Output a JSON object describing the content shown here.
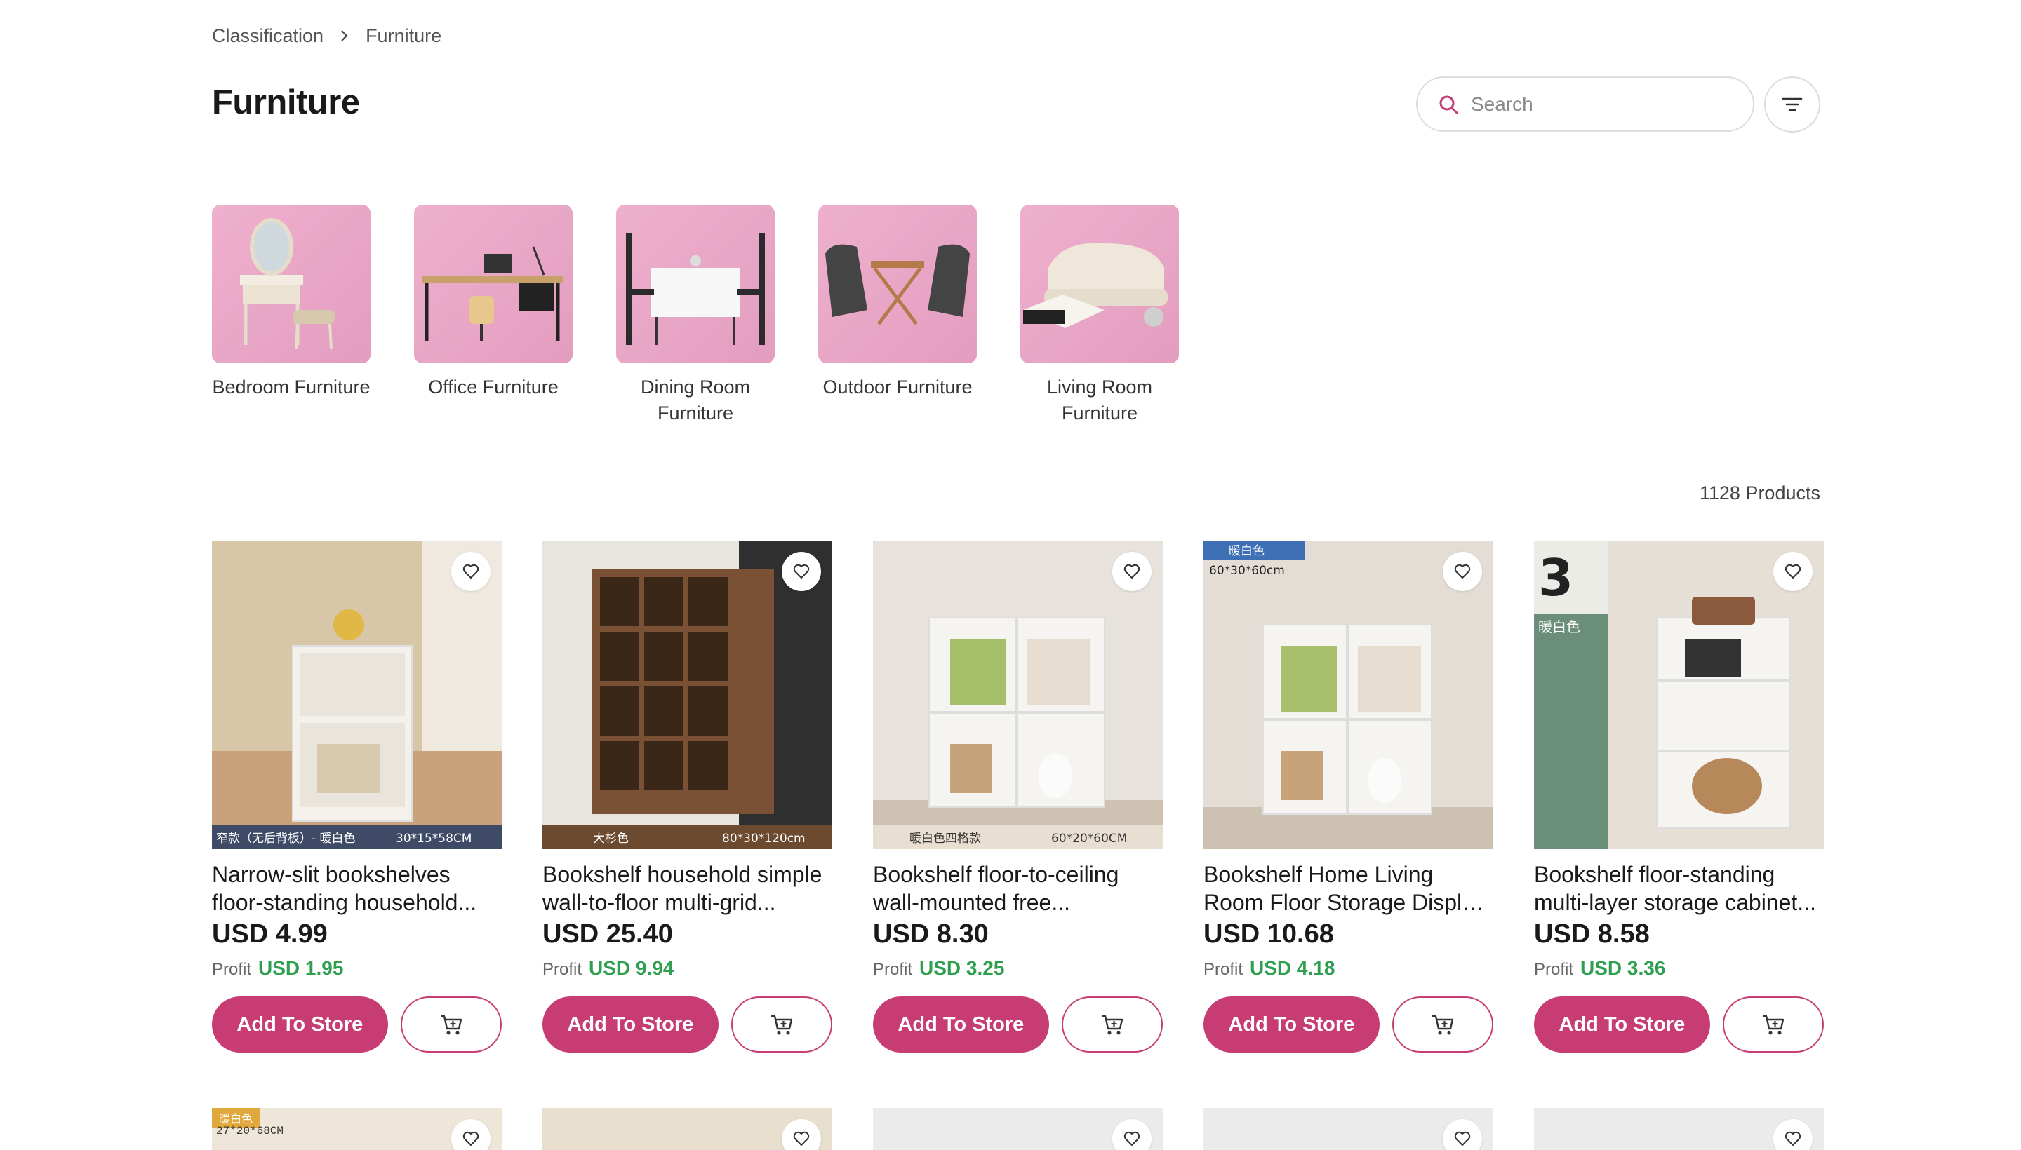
{
  "breadcrumb": {
    "root": "Classification",
    "current": "Furniture"
  },
  "page_title": "Furniture",
  "search": {
    "placeholder": "Search"
  },
  "categories": [
    {
      "label": "Bedroom Furniture"
    },
    {
      "label": "Office Furniture"
    },
    {
      "label": "Dining Room Furniture"
    },
    {
      "label": "Outdoor Furniture"
    },
    {
      "label": "Living Room Furniture"
    }
  ],
  "product_count": "1128 Products",
  "products": [
    {
      "title": "Narrow-slit bookshelves floor-standing household...",
      "price": "USD 4.99",
      "profit_label": "Profit",
      "profit": "USD 1.95",
      "add_label": "Add To Store",
      "img_left": "窄款（无后背板）- 暖白色",
      "img_right": "30*15*58CM"
    },
    {
      "title": "Bookshelf household simple wall-to-floor multi-grid...",
      "price": "USD 25.40",
      "profit_label": "Profit",
      "profit": "USD 9.94",
      "add_label": "Add To Store",
      "img_left": "大杉色",
      "img_right": "80*30*120cm"
    },
    {
      "title": "Bookshelf floor-to-ceiling wall-mounted free...",
      "price": "USD 8.30",
      "profit_label": "Profit",
      "profit": "USD 3.25",
      "add_label": "Add To Store",
      "img_left": "暖白色四格款",
      "img_right": "60*20*60CM"
    },
    {
      "title": "Bookshelf Home Living Room Floor Storage Display Cabin...",
      "price": "USD 10.68",
      "profit_label": "Profit",
      "profit": "USD 4.18",
      "add_label": "Add To Store",
      "img_tag": "暖白色",
      "img_size": "60*30*60cm"
    },
    {
      "title": "Bookshelf floor-standing multi-layer storage cabinet...",
      "price": "USD 8.58",
      "profit_label": "Profit",
      "profit": "USD 3.36",
      "add_label": "Add To Store",
      "img_tag": "暖白色",
      "img_num": "3"
    }
  ],
  "row2": [
    {
      "tag": "暖白色",
      "size": "27*20*68CM"
    }
  ],
  "colors": {
    "accent": "#c73c72",
    "profit": "#2e9e4f",
    "category_bg": "#e8a8c8"
  }
}
